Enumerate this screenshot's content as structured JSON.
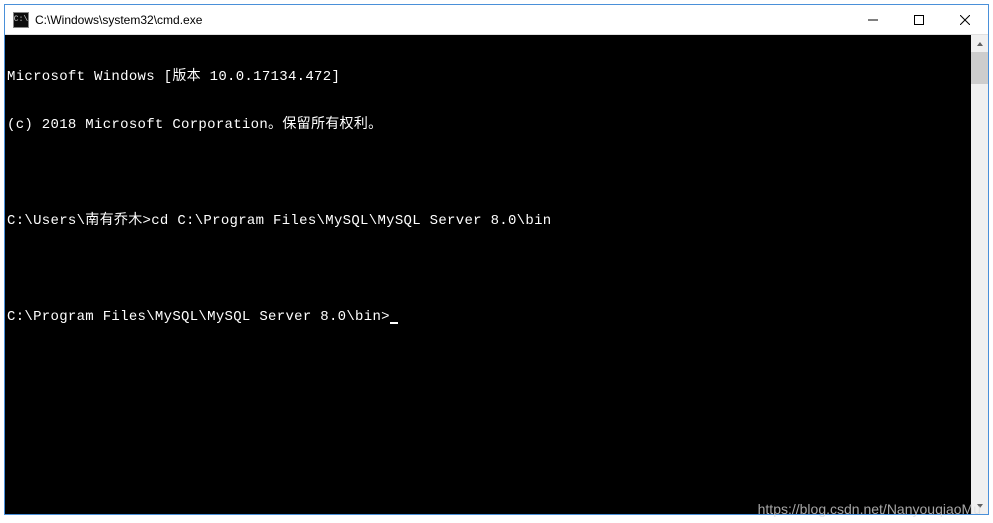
{
  "window": {
    "title": "C:\\Windows\\system32\\cmd.exe",
    "icon_label": "C:\\"
  },
  "console": {
    "lines": [
      "Microsoft Windows [版本 10.0.17134.472]",
      "(c) 2018 Microsoft Corporation。保留所有权利。",
      "",
      "C:\\Users\\南有乔木>cd C:\\Program Files\\MySQL\\MySQL Server 8.0\\bin",
      "",
      "C:\\Program Files\\MySQL\\MySQL Server 8.0\\bin>"
    ]
  },
  "watermark": "https://blog.csdn.net/NanyouqiaoMu"
}
